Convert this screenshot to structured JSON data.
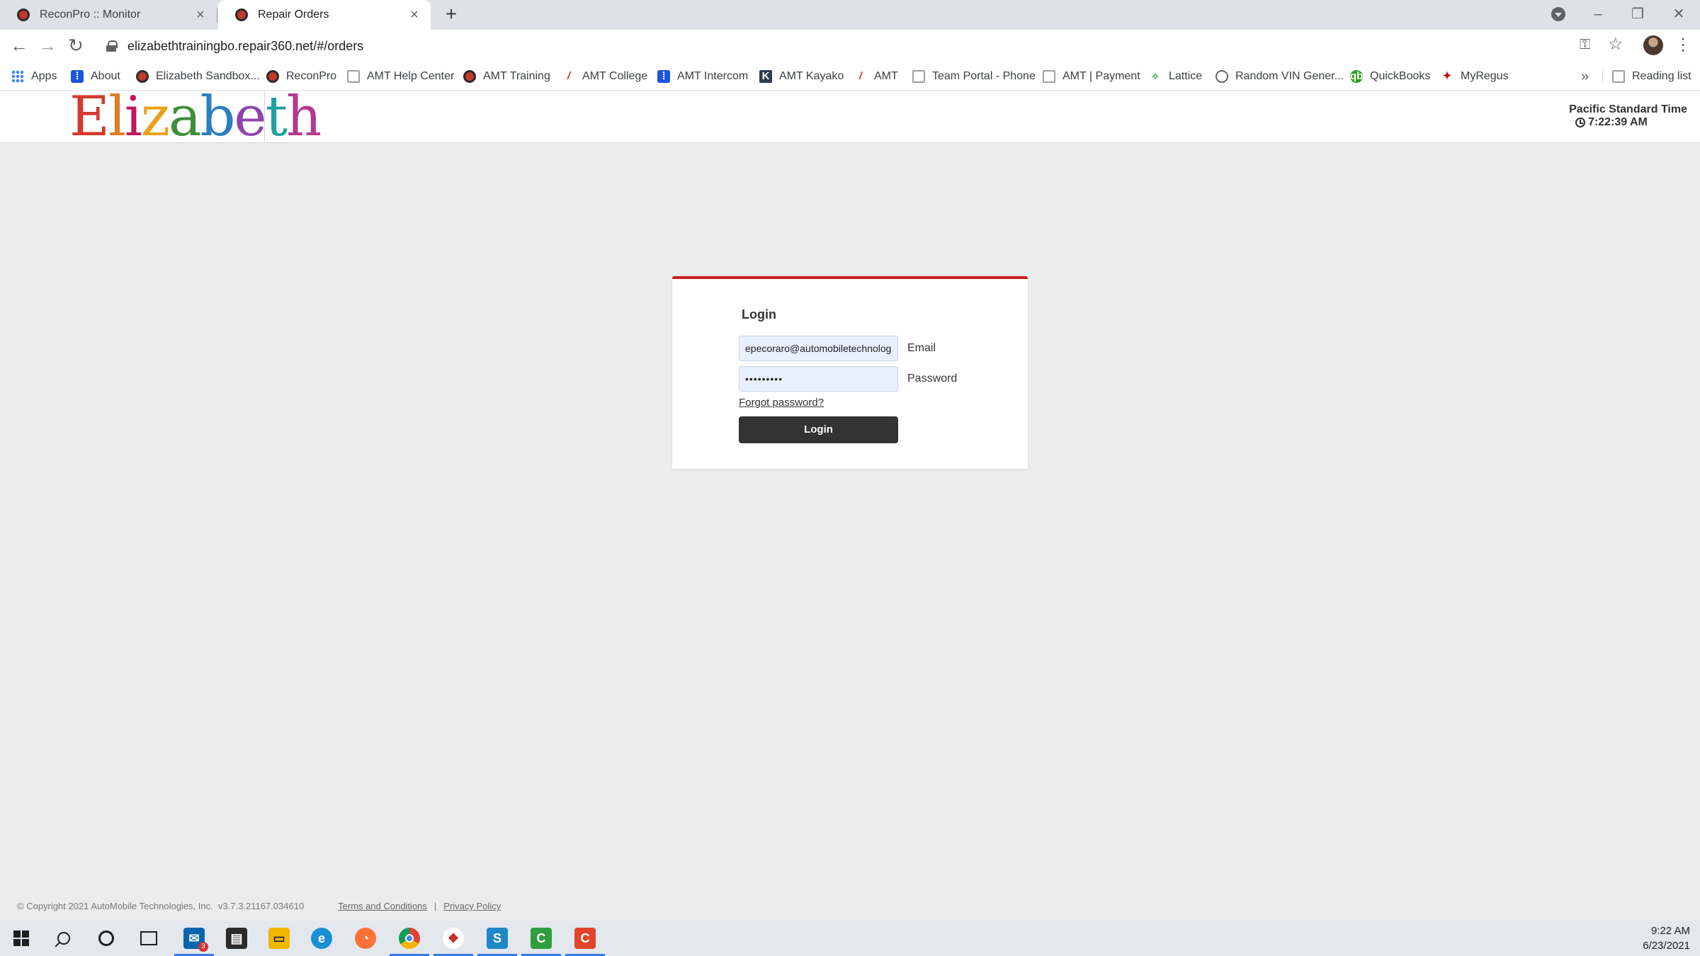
{
  "browser": {
    "tabs": [
      {
        "title": "ReconPro :: Monitor",
        "active": false
      },
      {
        "title": "Repair Orders",
        "active": true
      }
    ],
    "new_tab_label": "+",
    "url_host": "elizabethtrainingbo.repair360.net",
    "url_path": "/#/orders",
    "bookmarks": [
      {
        "label": "Apps",
        "icon": "apps-grid-icon"
      },
      {
        "label": "About",
        "icon": "intercom-icon"
      },
      {
        "label": "Elizabeth Sandbox...",
        "icon": "target-icon"
      },
      {
        "label": "ReconPro",
        "icon": "target-icon"
      },
      {
        "label": "AMT Help Center",
        "icon": "book-icon"
      },
      {
        "label": "AMT Training",
        "icon": "target-icon"
      },
      {
        "label": "AMT College",
        "icon": "amt-icon"
      },
      {
        "label": "AMT Intercom",
        "icon": "intercom-icon"
      },
      {
        "label": "AMT Kayako",
        "icon": "kayako-icon"
      },
      {
        "label": "AMT",
        "icon": "amt-icon"
      },
      {
        "label": "Team Portal - Phone",
        "icon": "doc-icon"
      },
      {
        "label": "AMT | Payment",
        "icon": "doc-icon"
      },
      {
        "label": "Lattice",
        "icon": "lattice-icon"
      },
      {
        "label": "Random VIN Gener...",
        "icon": "globe-icon"
      },
      {
        "label": "QuickBooks",
        "icon": "quickbooks-icon"
      },
      {
        "label": "MyRegus",
        "icon": "regus-icon"
      }
    ],
    "more_bookmarks": "»",
    "reading_list": "Reading list"
  },
  "header": {
    "logo_text": "Elizabeth",
    "timezone": "Pacific Standard Time",
    "time": "7:22:39 AM"
  },
  "login": {
    "title": "Login",
    "email_value": "epecoraro@automobiletechnologies.com",
    "email_label": "Email",
    "password_value": "•••••••••",
    "password_label": "Password",
    "forgot_link": "Forgot password?",
    "submit_label": "Login",
    "accent_color": "#cc1f1f"
  },
  "footer": {
    "copyright": "© Copyright 2021 AutoMobile Technologies, Inc.",
    "version": "v3.7.3.21167.034610",
    "terms": "Terms and Conditions",
    "separator": "|",
    "privacy": "Privacy Policy"
  },
  "taskbar": {
    "time": "9:22 AM",
    "date": "6/23/2021",
    "badge_count": "3"
  }
}
